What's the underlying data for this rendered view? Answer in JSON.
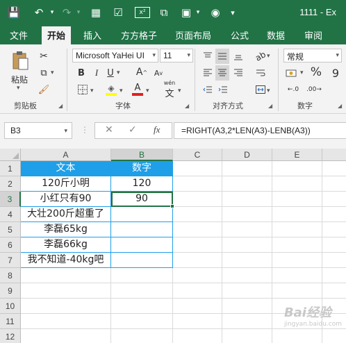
{
  "title": "1111 - Ex",
  "qat": {
    "save_icon": "💾",
    "undo_icon": "↶",
    "redo_icon": "↷",
    "form_icon": "▦",
    "check_icon": "☑",
    "superscript_label": "x²",
    "special_icon": "⧉",
    "camera_icon": "◉"
  },
  "tabs": [
    "文件",
    "开始",
    "插入",
    "方方格子",
    "页面布局",
    "公式",
    "数据",
    "审阅"
  ],
  "ribbon": {
    "clipboard": {
      "paste_label": "粘贴",
      "group_label": "剪贴板"
    },
    "font": {
      "name": "Microsoft YaHei UI",
      "size": "11",
      "bold": "B",
      "italic": "I",
      "underline": "U",
      "grow": "A",
      "shrink": "A",
      "font_color": "A",
      "wen": "wén",
      "group_label": "字体"
    },
    "alignment": {
      "group_label": "对齐方式"
    },
    "number": {
      "format": "常规",
      "percent": "%",
      "group_label": "数字"
    }
  },
  "formula_bar": {
    "name_box": "B3",
    "cancel": "✕",
    "enter": "✓",
    "fx": "fx",
    "formula": "=RIGHT(A3,2*LEN(A3)-LENB(A3))"
  },
  "grid": {
    "columns": [
      "A",
      "B",
      "C",
      "D",
      "E"
    ],
    "rows": [
      "1",
      "2",
      "3",
      "4",
      "5",
      "6",
      "7",
      "8",
      "9",
      "10",
      "11",
      "12"
    ],
    "cells": {
      "A1": "文本",
      "B1": "数字",
      "A2": "120斤小明",
      "B2": "120",
      "A3": "小红只有90",
      "B3": "90",
      "A4": "大壮200斤超重了",
      "B4": "",
      "A5": "李磊65kg",
      "B5": "",
      "A6": "李磊66kg",
      "B6": "",
      "A7": "我不知道-40kg吧",
      "B7": ""
    },
    "selected": "B3"
  },
  "colors": {
    "excel_green": "#217346",
    "header_fill": "#1e9fe8",
    "table_border": "#1e9fe8"
  },
  "watermark": {
    "text": "Bai经验",
    "sub": "jingyan.baidu.com"
  }
}
